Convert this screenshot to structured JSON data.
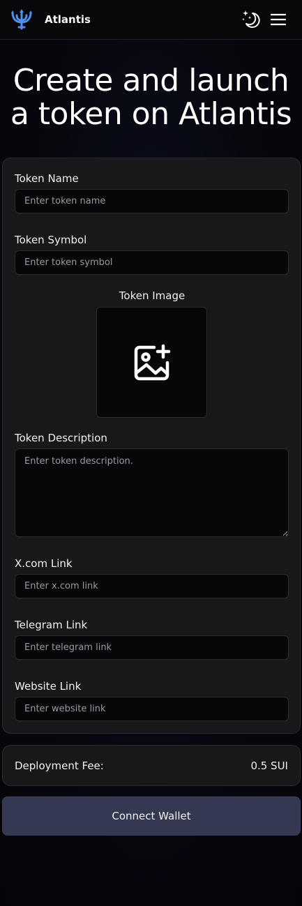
{
  "header": {
    "brand": "Atlantis",
    "logo_icon": "trident-logo-icon",
    "theme_icon": "moon-stars-icon",
    "menu_icon": "hamburger-menu-icon",
    "accent_color": "#4f8ff0"
  },
  "hero": {
    "title": "Create and launch a token on Atlantis"
  },
  "form": {
    "token_name": {
      "label": "Token Name",
      "placeholder": "Enter token name",
      "value": ""
    },
    "token_symbol": {
      "label": "Token Symbol",
      "placeholder": "Enter token symbol",
      "value": ""
    },
    "token_image": {
      "label": "Token Image",
      "icon": "image-plus-icon"
    },
    "token_description": {
      "label": "Token Description",
      "placeholder": "Enter token description.",
      "value": ""
    },
    "x_link": {
      "label": "X.com Link",
      "placeholder": "Enter x.com link",
      "value": ""
    },
    "telegram_link": {
      "label": "Telegram Link",
      "placeholder": "Enter telegram link",
      "value": ""
    },
    "website_link": {
      "label": "Website Link",
      "placeholder": "Enter website link",
      "value": ""
    }
  },
  "fee": {
    "label": "Deployment Fee:",
    "value": "0.5 SUI"
  },
  "actions": {
    "connect_label": "Connect Wallet",
    "button_color": "#343850"
  }
}
